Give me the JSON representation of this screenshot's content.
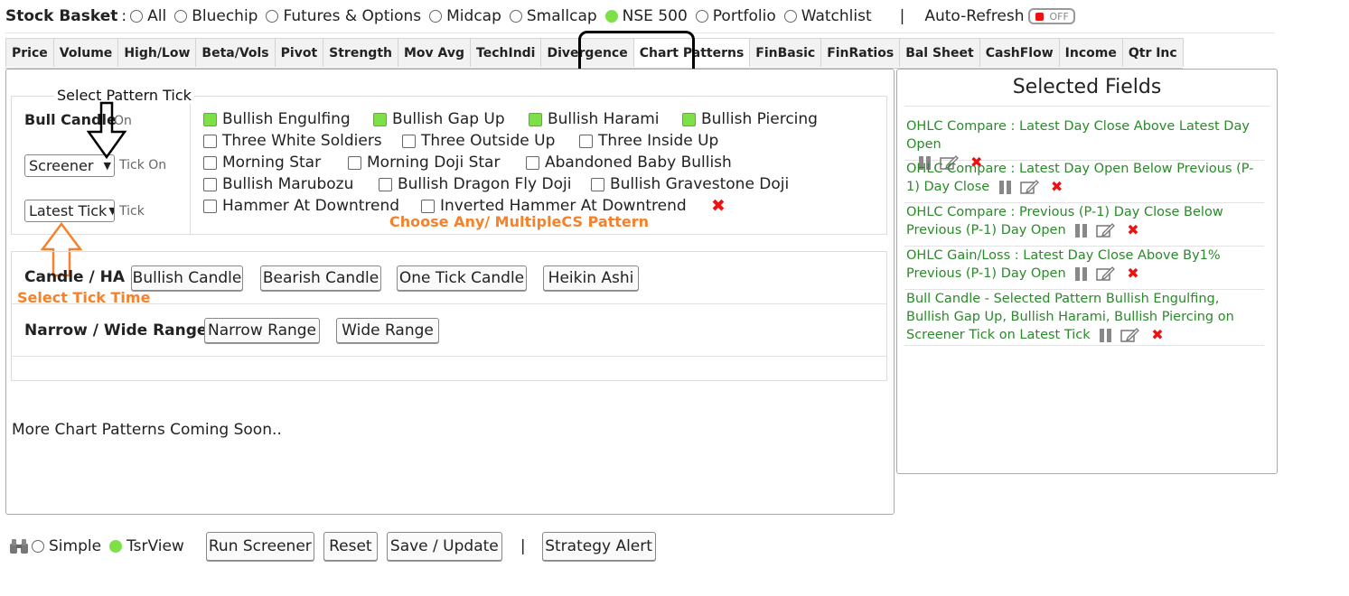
{
  "basket": {
    "title": "Stock Basket",
    "separator": ":",
    "options": [
      {
        "label": "All",
        "selected": false
      },
      {
        "label": "Bluechip",
        "selected": false
      },
      {
        "label": "Futures & Options",
        "selected": false
      },
      {
        "label": "Midcap",
        "selected": false
      },
      {
        "label": "Smallcap",
        "selected": false
      },
      {
        "label": "NSE 500",
        "selected": true
      },
      {
        "label": "Portfolio",
        "selected": false
      },
      {
        "label": "Watchlist",
        "selected": false
      }
    ],
    "pipe": "|",
    "auto_refresh_label": "Auto-Refresh",
    "auto_refresh_state": "OFF"
  },
  "tabs": [
    {
      "label": "Price",
      "active": false
    },
    {
      "label": "Volume",
      "active": false
    },
    {
      "label": "High/Low",
      "active": false
    },
    {
      "label": "Beta/Vols",
      "active": false
    },
    {
      "label": "Pivot",
      "active": false
    },
    {
      "label": "Strength",
      "active": false
    },
    {
      "label": "Mov Avg",
      "active": false
    },
    {
      "label": "TechIndi",
      "active": false
    },
    {
      "label": "Divergence",
      "active": false
    },
    {
      "label": "Chart Patterns",
      "active": true
    },
    {
      "label": "FinBasic",
      "active": false
    },
    {
      "label": "FinRatios",
      "active": false
    },
    {
      "label": "Bal Sheet",
      "active": false
    },
    {
      "label": "CashFlow",
      "active": false
    },
    {
      "label": "Income",
      "active": false
    },
    {
      "label": "Qtr Inc",
      "active": false
    }
  ],
  "pattern": {
    "legend": "Select Pattern Tick",
    "bull_label": "Bull Candle",
    "on_label": "On",
    "screener_select": "Screener",
    "tick_on_label": "Tick On",
    "latest_select": "Latest Tick",
    "tick_label": "Tick",
    "checkboxes": [
      {
        "label": "Bullish Engulfing",
        "checked": true
      },
      {
        "label": "Bullish Gap Up",
        "checked": true
      },
      {
        "label": "Bullish Harami",
        "checked": true
      },
      {
        "label": "Bullish Piercing",
        "checked": true
      },
      {
        "label": "Three White Soldiers",
        "checked": false
      },
      {
        "label": "Three Outside Up",
        "checked": false
      },
      {
        "label": "Three Inside Up",
        "checked": false
      },
      {
        "label": "Morning Star",
        "checked": false
      },
      {
        "label": "Morning Doji Star",
        "checked": false
      },
      {
        "label": "Abandoned Baby Bullish",
        "checked": false
      },
      {
        "label": "Bullish Marubozu",
        "checked": false
      },
      {
        "label": "Bullish Dragon Fly Doji",
        "checked": false
      },
      {
        "label": "Bullish Gravestone Doji",
        "checked": false
      },
      {
        "label": "Hammer At Downtrend",
        "checked": false
      },
      {
        "label": "Inverted Hammer At Downtrend",
        "checked": false
      }
    ],
    "clear_icon": "✖"
  },
  "annotations": {
    "choose": "Choose Any/ MultipleCS Pattern",
    "select_tick": "Select Tick Time"
  },
  "candle": {
    "label": "Candle / HA :",
    "buttons": [
      "Bullish Candle",
      "Bearish Candle",
      "One Tick Candle",
      "Heikin Ashi"
    ]
  },
  "range": {
    "label": "Narrow / Wide Range :",
    "buttons": [
      "Narrow Range",
      "Wide Range"
    ]
  },
  "coming_soon": "More Chart Patterns Coming Soon..",
  "selected_fields": {
    "title": "Selected Fields",
    "items": [
      {
        "text": "OHLC Compare : Latest Day Close Above Latest Day Open"
      },
      {
        "text": "OHLC Compare : Latest Day Open Below Previous (P-1) Day Close"
      },
      {
        "text": "OHLC Compare : Previous (P-1) Day Close Below Previous (P-1) Day Open"
      },
      {
        "text": "OHLC Gain/Loss : Latest Day Close Above By1% Previous (P-1) Day Open"
      },
      {
        "text": "Bull Candle - Selected Pattern Bullish Engulfing, Bullish Gap Up, Bullish Harami, Bullish Piercing on Screener Tick on Latest Tick"
      }
    ],
    "delete_icon": "✖"
  },
  "bottom": {
    "view_options": [
      {
        "label": "Simple",
        "selected": false
      },
      {
        "label": "TsrView",
        "selected": true
      }
    ],
    "buttons": [
      "Run Screener",
      "Reset",
      "Save / Update"
    ],
    "pipe": "|",
    "alert_button": "Strategy Alert"
  },
  "colors": {
    "selected_green": "#7ee048",
    "field_text_green": "#2a8a2a",
    "annotation_orange": "#f5822a",
    "delete_red": "#e11111"
  }
}
